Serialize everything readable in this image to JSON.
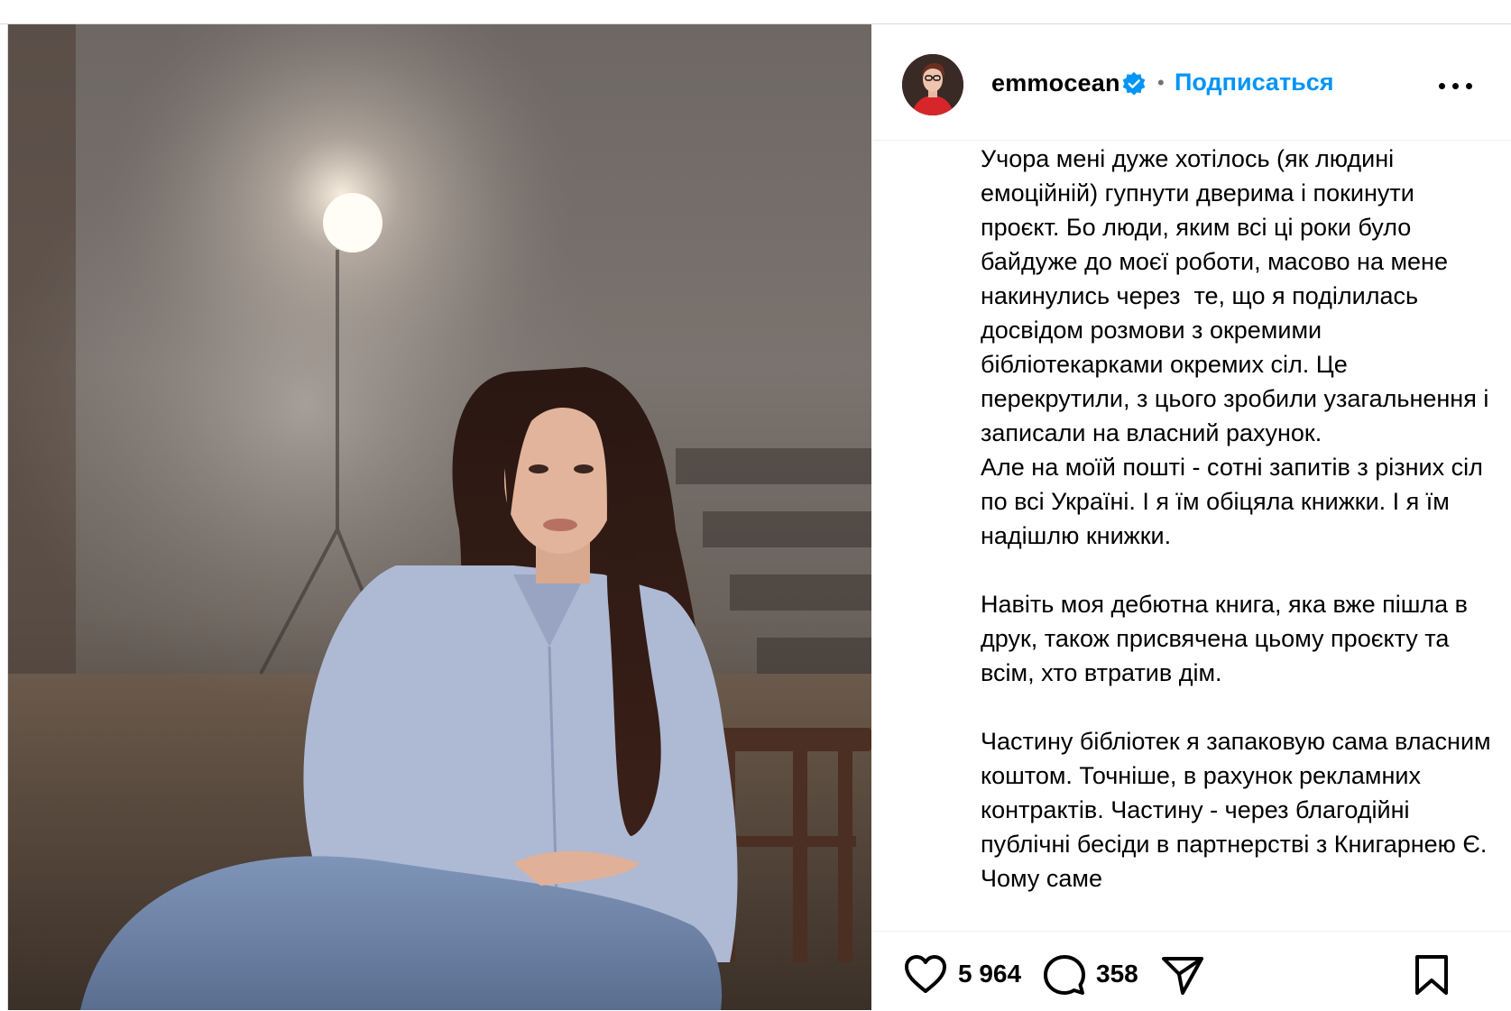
{
  "post": {
    "username": "emmocean",
    "separator": "•",
    "follow_label": "Подписаться",
    "caption": [
      "Учора мені дуже хотілось (як людині емоційній) гупнути дверима і покинути проєкт. Бо люди, яким всі ці роки було байдуже до моєї роботи, масово на мене накинулись через  те, що я поділилась досвідом розмови з окремими бібліотекарками окремих сіл. Це перекрутили, з цього зробили узагальнення і записали на власний рахунок.\nАле на моїй пошті - сотні запитів з різних сіл по всі Україні. І я їм обіцяла книжки. І я їм надішлю книжки.",
      "Навіть моя дебютна книга, яка вже пішла в друк, також присвячена цьому проєкту та всім, хто втратив дім.",
      "Частину бібліотек я запаковую сама власним коштом. Точніше, в рахунок рекламних контрактів. Частину - через благодійні публічні бесіди в партнерстві з Книгарнею Є. Чому саме"
    ],
    "likes": "5 964",
    "comments": "358"
  },
  "icons": {
    "verified": "verified-badge-icon",
    "more": "more-options-icon",
    "like": "heart-icon",
    "comment": "comment-bubble-icon",
    "share": "paper-plane-icon",
    "save": "bookmark-icon"
  },
  "colors": {
    "follow": "#0095f6",
    "verified": "#0095f6",
    "border": "#dbdbdb"
  }
}
